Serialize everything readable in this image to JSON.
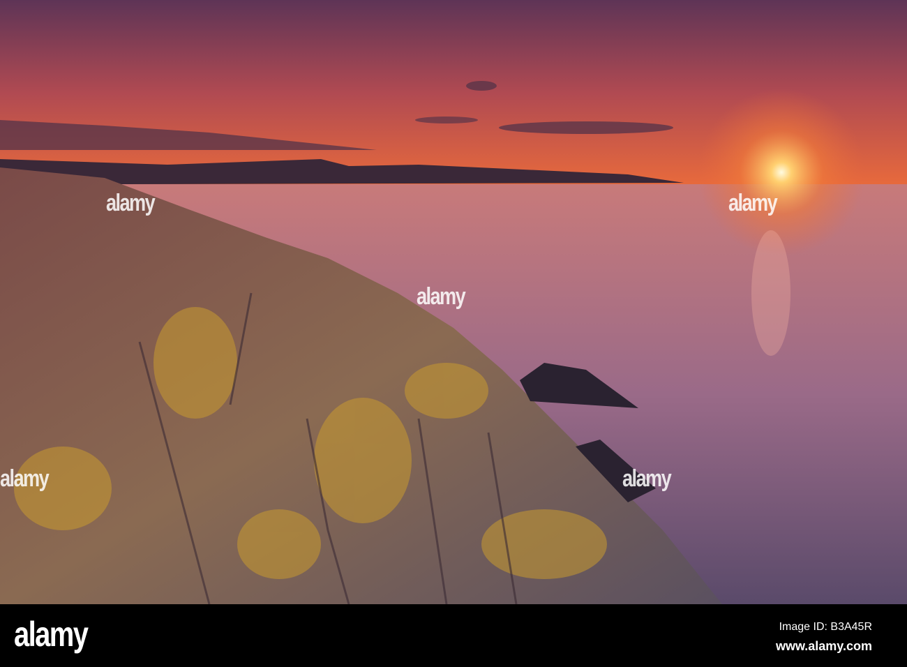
{
  "scene": "Coastal sunset over rocky shore",
  "colors": {
    "sky_top": "#6a3a5a",
    "sky_horizon": "#e0603a",
    "sun": "#fff4c0",
    "sea": "#b07a8a",
    "rock": "#8a6a5a",
    "lichen": "#c89a30"
  },
  "watermark": {
    "text": "alamy"
  },
  "footer": {
    "logo": "alamy",
    "image_id": "Image ID: B3A45R",
    "url": "www.alamy.com"
  }
}
